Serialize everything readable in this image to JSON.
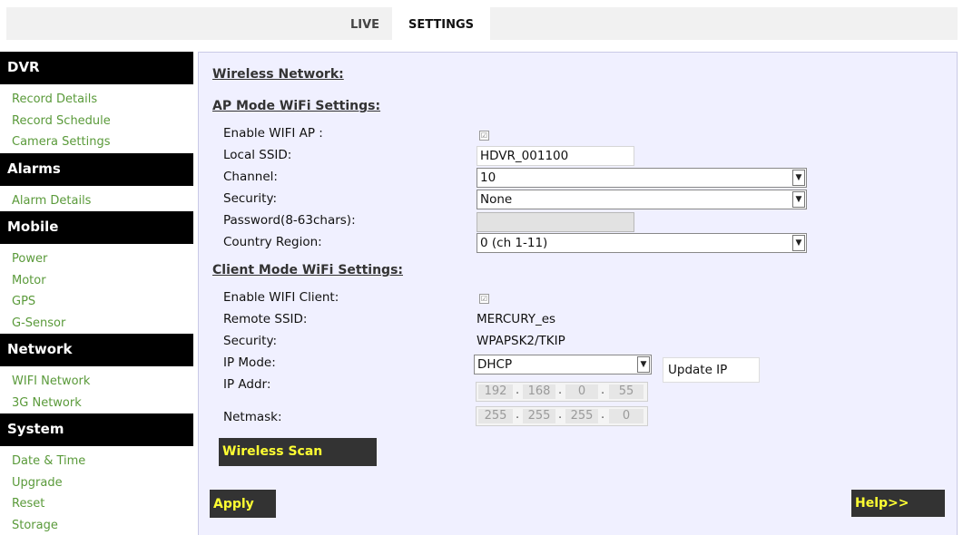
{
  "tabs": [
    {
      "label": "LIVE"
    },
    {
      "label": "SETTINGS"
    }
  ],
  "sidebar": {
    "sections": [
      {
        "title": "DVR",
        "items": [
          "Record Details",
          "Record Schedule",
          "Camera Settings"
        ]
      },
      {
        "title": "Alarms",
        "items": [
          "Alarm Details"
        ]
      },
      {
        "title": "Mobile",
        "items": [
          "Power",
          "Motor",
          "GPS",
          "G-Sensor"
        ]
      },
      {
        "title": "Network",
        "items": [
          "WIFI Network",
          "3G Network"
        ]
      },
      {
        "title": "System",
        "items": [
          "Date & Time",
          "Upgrade",
          "Reset",
          "Storage"
        ]
      }
    ]
  },
  "main": {
    "title": "Wireless Network:",
    "ap": {
      "heading": "AP Mode WiFi Settings:",
      "enable_label": "Enable WIFI AP :",
      "enable_checked": true,
      "ssid_label": "Local SSID:",
      "ssid_value": "HDVR_001100",
      "channel_label": "Channel:",
      "channel_value": "10",
      "security_label": "Security:",
      "security_value": "None",
      "password_label": "Password(8-63chars):",
      "password_value": "",
      "region_label": "Country Region:",
      "region_value": "0 (ch 1-11)"
    },
    "client": {
      "heading": "Client Mode WiFi Settings:",
      "enable_label": "Enable WIFI Client:",
      "enable_checked": true,
      "remote_ssid_label": "Remote SSID:",
      "remote_ssid_value": "MERCURY_es",
      "security_label": "Security:",
      "security_value": "WPAPSK2/TKIP",
      "ipmode_label": "IP Mode:",
      "ipmode_value": "DHCP",
      "update_ip_label": "Update IP",
      "ipaddr_label": "IP Addr:",
      "ipaddr": [
        "192",
        "168",
        "0",
        "55"
      ],
      "netmask_label": "Netmask:",
      "netmask": [
        "255",
        "255",
        "255",
        "0"
      ]
    },
    "wireless_scan_label": "Wireless Scan",
    "apply_label": "Apply",
    "help_label": "Help>>"
  },
  "colors": {
    "sidebar_link": "#5a9a3a",
    "button_text": "#ffff33",
    "button_bg": "#333333",
    "panel_bg": "#f0f0ff"
  },
  "icons": {
    "checkbox": "check-icon",
    "dropdown": "chevron-down-icon"
  }
}
